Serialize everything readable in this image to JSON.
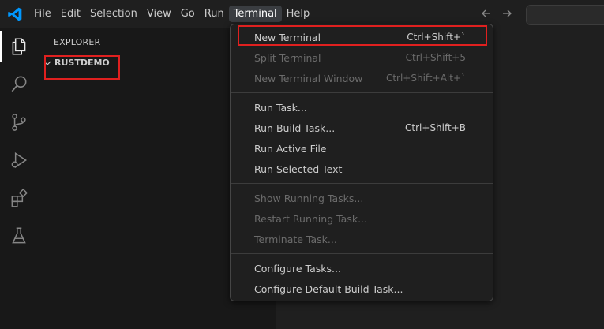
{
  "menubar": {
    "items": [
      "File",
      "Edit",
      "Selection",
      "View",
      "Go",
      "Run",
      "Terminal",
      "Help"
    ],
    "active_index": 6
  },
  "sidebar": {
    "title": "EXPLORER",
    "folder": "RUSTDEMO"
  },
  "terminal_menu": {
    "items": [
      {
        "label": "New Terminal",
        "shortcut": "Ctrl+Shift+`",
        "enabled": true
      },
      {
        "label": "Split Terminal",
        "shortcut": "Ctrl+Shift+5",
        "enabled": false
      },
      {
        "label": "New Terminal Window",
        "shortcut": "Ctrl+Shift+Alt+`",
        "enabled": false
      },
      {
        "label": "Run Task...",
        "shortcut": "",
        "enabled": true
      },
      {
        "label": "Run Build Task...",
        "shortcut": "Ctrl+Shift+B",
        "enabled": true
      },
      {
        "label": "Run Active File",
        "shortcut": "",
        "enabled": true
      },
      {
        "label": "Run Selected Text",
        "shortcut": "",
        "enabled": true
      },
      {
        "label": "Show Running Tasks...",
        "shortcut": "",
        "enabled": false
      },
      {
        "label": "Restart Running Task...",
        "shortcut": "",
        "enabled": false
      },
      {
        "label": "Terminate Task...",
        "shortcut": "",
        "enabled": false
      },
      {
        "label": "Configure Tasks...",
        "shortcut": "",
        "enabled": true
      },
      {
        "label": "Configure Default Build Task...",
        "shortcut": "",
        "enabled": true
      }
    ]
  },
  "colors": {
    "accent_highlight": "#e0201f",
    "logo_blue": "#0098ff"
  }
}
